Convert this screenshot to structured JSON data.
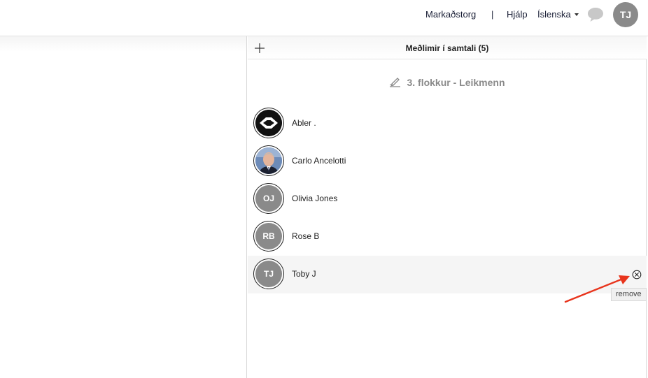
{
  "nav": {
    "marketplace": "Markaðstorg",
    "separator": "|",
    "help": "Hjálp",
    "language": "Íslenska",
    "user_initials": "TJ"
  },
  "members_panel": {
    "title": "Meðlimir í samtali (5)",
    "group_name": "3. flokkur - Leikmenn",
    "members": [
      {
        "name": "Abler .",
        "initials": "",
        "avatar": "abler-logo"
      },
      {
        "name": "Carlo Ancelotti",
        "initials": "",
        "avatar": "photo"
      },
      {
        "name": "Olivia Jones",
        "initials": "OJ"
      },
      {
        "name": "Rose B",
        "initials": "RB"
      },
      {
        "name": "Toby J",
        "initials": "TJ"
      }
    ],
    "remove_tooltip": "remove"
  },
  "colors": {
    "avatar_gray": "#8a8a8a",
    "annotation_red": "#e8341c",
    "hover_row": "#f5f5f5"
  },
  "icons": {
    "add": "plus-icon",
    "chat": "chat-bubble-icon",
    "edit": "edit-icon",
    "remove": "remove-circle-icon"
  }
}
